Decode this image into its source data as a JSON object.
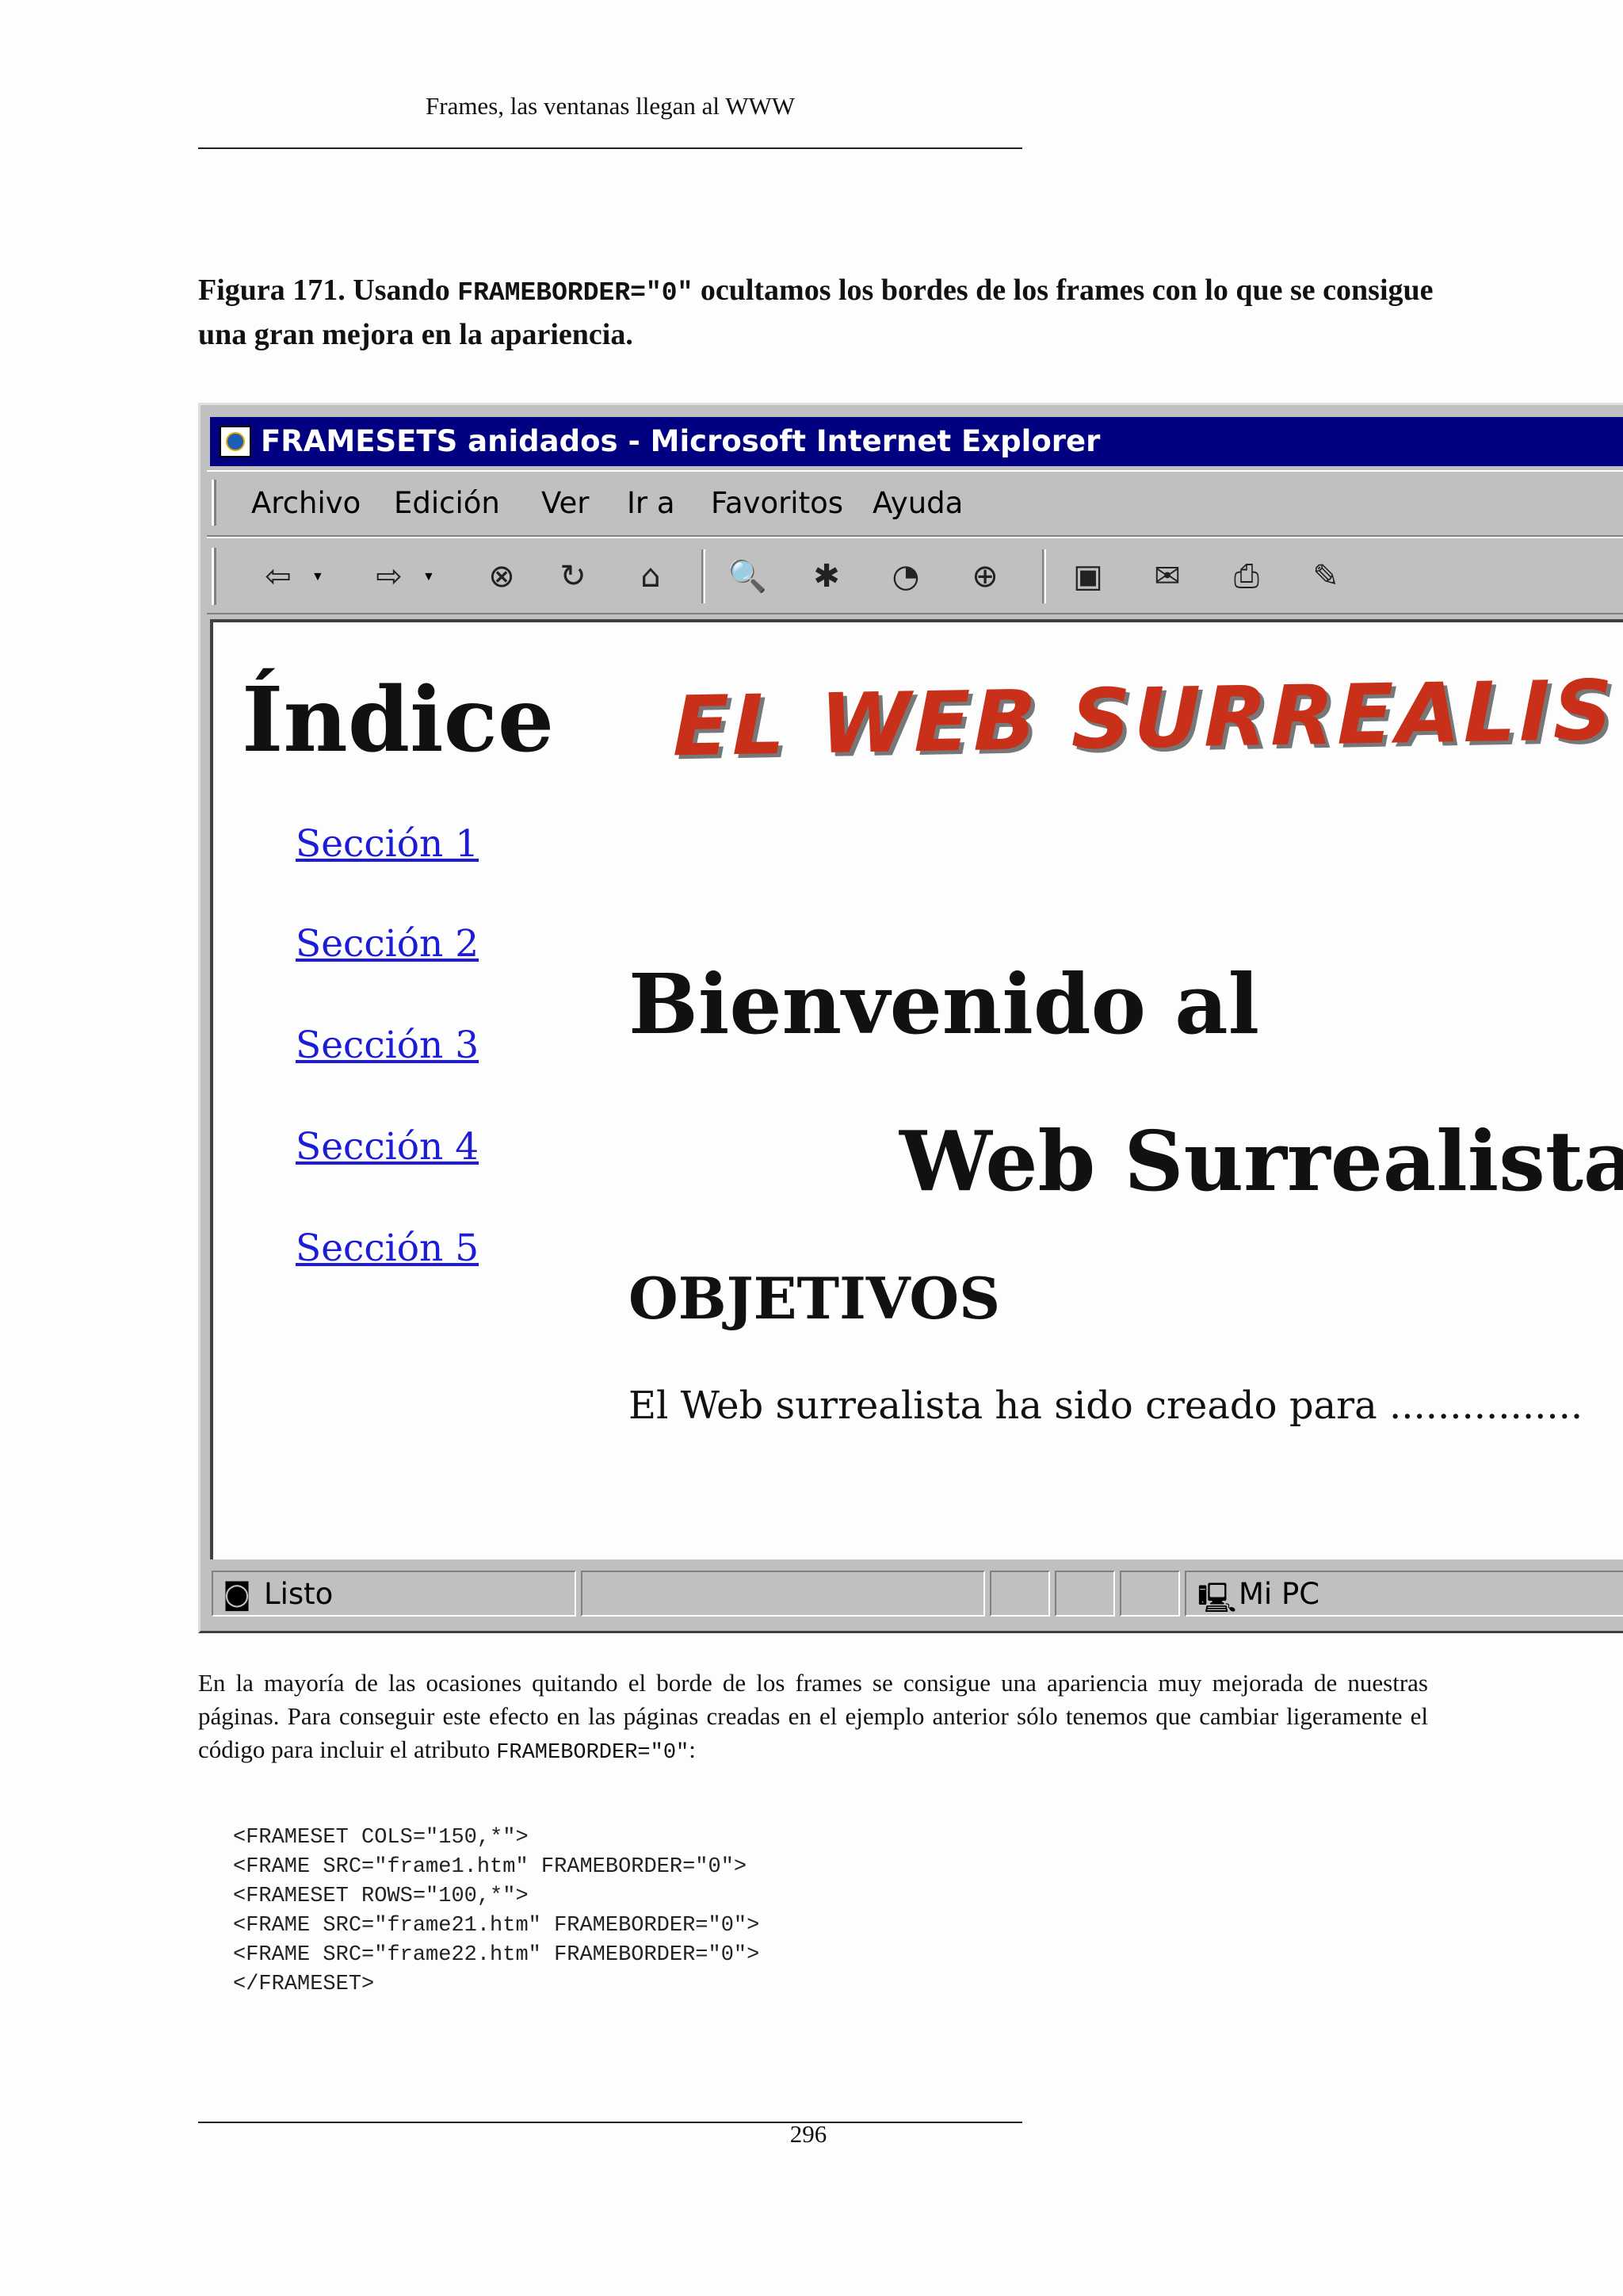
{
  "header": {
    "running_title": "Frames, las ventanas llegan al WWW"
  },
  "caption": {
    "label": "Figura 171.",
    "before_code": "Usando",
    "code": "FRAMEBORDER=\"0\"",
    "after_code": "ocultamos los bordes de los frames con lo que se consigue una gran mejora en la apariencia."
  },
  "browser": {
    "title": "FRAMESETS anidados - Microsoft Internet Explorer",
    "menu": [
      "Archivo",
      "Edición",
      "Ver",
      "Ir a",
      "Favoritos",
      "Ayuda"
    ],
    "toolbar_icons": [
      "back-icon",
      "forward-icon",
      "stop-icon",
      "refresh-icon",
      "home-icon",
      "search-icon",
      "favorites-icon",
      "history-icon",
      "channels-icon",
      "fullscreen-icon",
      "mail-icon",
      "print-icon",
      "edit-icon"
    ],
    "left_frame": {
      "title": "Índice",
      "links": [
        "Sección 1",
        "Sección 2",
        "Sección 3",
        "Sección 4",
        "Sección 5"
      ]
    },
    "banner": "EL WEB SURREALIS",
    "main_frame": {
      "welcome_line1": "Bienvenido al",
      "welcome_line2": "Web Surrealista",
      "heading": "OBJETIVOS",
      "text": "El Web surrealista ha sido creado para ................"
    },
    "status": {
      "left": "Listo",
      "zone": "Mi PC"
    }
  },
  "body": {
    "paragraph_before_code": "En la mayoría de las ocasiones quitando el borde de los frames se consigue una apariencia muy mejorada de nuestras páginas.  Para conseguir este efecto en las páginas creadas en el ejemplo anterior sólo tenemos que cambiar ligeramente el código para incluir el atributo",
    "paragraph_code": "FRAMEBORDER=\"0\"",
    "paragraph_after_code": ":",
    "code_lines": [
      "<FRAMESET COLS=\"150,*\">",
      "<FRAME SRC=\"frame1.htm\" FRAMEBORDER=\"0\">",
      "<FRAMESET ROWS=\"100,*\">",
      "<FRAME SRC=\"frame21.htm\" FRAMEBORDER=\"0\">",
      "<FRAME SRC=\"frame22.htm\" FRAMEBORDER=\"0\">",
      "</FRAMESET>"
    ]
  },
  "footer": {
    "page_number": "296"
  }
}
